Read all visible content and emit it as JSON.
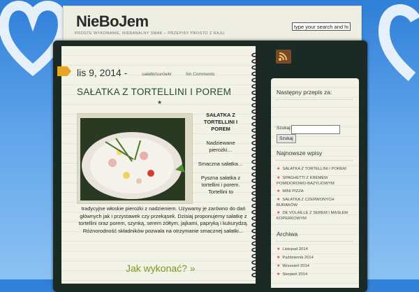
{
  "header": {
    "logo": "NieBoJem",
    "tagline": "PROSTE WYKONANIE, NIEBANALNY SMAK – PRZEPISY PROSTO Z RAJU",
    "search_value": "type your search and hit"
  },
  "post": {
    "date": "lis 9, 2014 -",
    "category": "sałatki/surówki",
    "comments": "No Comments",
    "title": "SAŁATKA Z TORTELLINI I POREM",
    "side_title": "SAŁATKA Z TORTELLINI I POREM",
    "side_lines": [
      "Nadziewane pierożki…",
      "Smaczna sałatka…",
      "Pyszna sałatka z tortellini i porem. Tortellini to"
    ],
    "body": "tradycyjne włoskie pierożki z nadzieniem. Używamy je zarówno do dań głównych jak i przystawek czy przekąsek. Dzisiaj proponujemy sałatkę z tortellini oraz porem, szynką, serem żółtym, jajkami, papryką i kukurydzą. Różnorodność składników pozwala na otrzymanie smacznej sałatki…",
    "howto": "Jak wykonać? »"
  },
  "sidebar": {
    "next_heading": "Następny przepis za:",
    "search_label": "Szukaj:",
    "search_button": "Szukaj",
    "newest_heading": "Najnowsze wpisy",
    "newest": [
      "SAŁATKA Z TORTELLINI I POREM",
      "SPAGHETTI Z KREMEM POMIDOROWO-BAZYLIOWYM",
      "MINI PIZZA",
      "SAŁATKA Z CZERWONYCH BURAKÓW",
      "DE VOLAILLE Z SEREM I MASŁEM KOPERKOWYM"
    ],
    "archive_heading": "Archiwa",
    "archive": [
      "Listopad 2014",
      "Październik 2014",
      "Wrzesień 2014",
      "Sierpień 2014"
    ]
  }
}
